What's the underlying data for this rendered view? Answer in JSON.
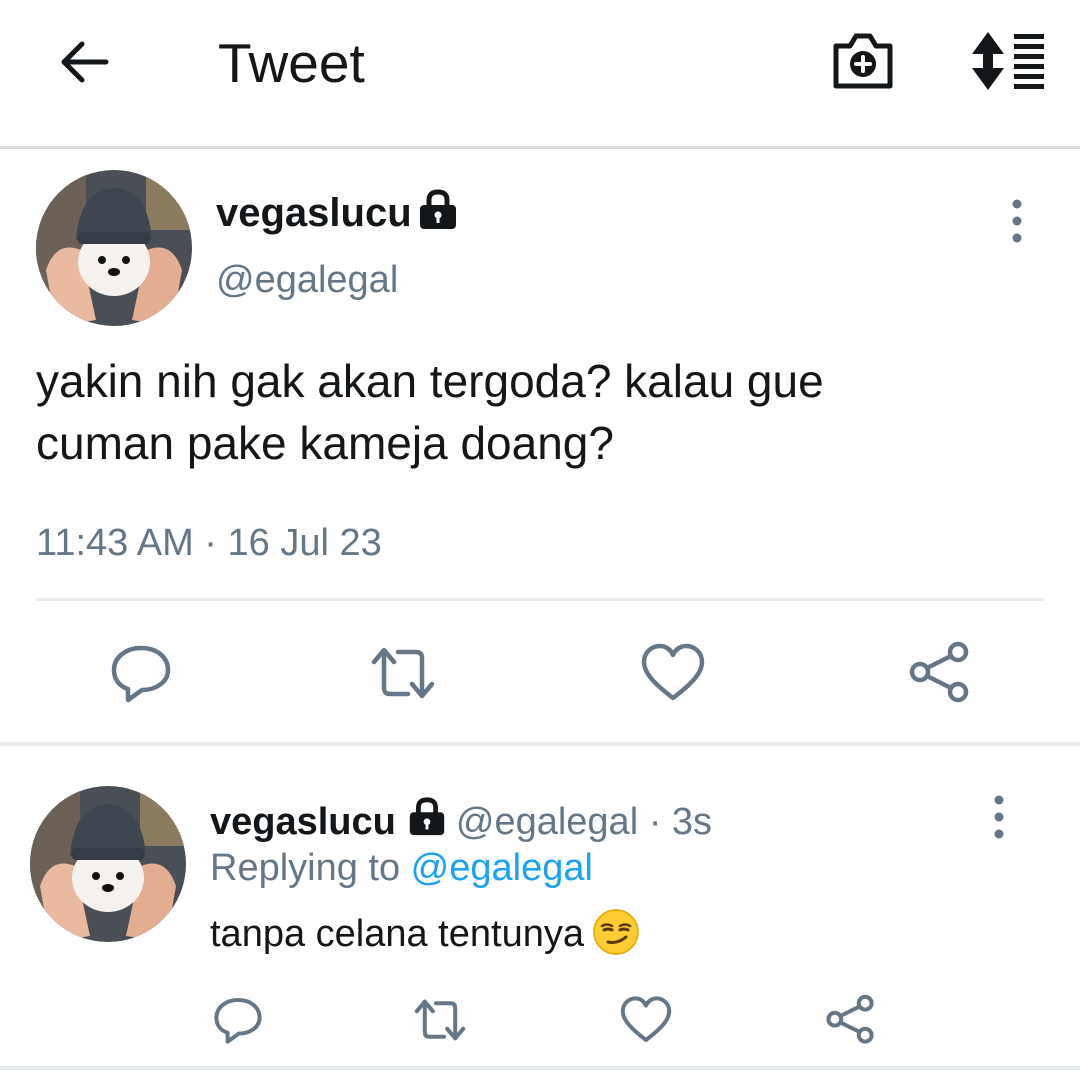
{
  "header": {
    "title": "Tweet",
    "back_icon": "arrow-left-icon",
    "camera_icon": "camera-add-icon",
    "sort_icon": "sort-list-icon"
  },
  "main_tweet": {
    "display_name": "vegaslucu",
    "handle": "@egalegal",
    "text_line1": "yakin nih gak akan tergoda? kalau gue",
    "text_line2": "cuman pake kameja doang?",
    "timestamp": "11:43 AM · 16 Jul 23",
    "protected_icon": "lock-icon",
    "more_icon": "more-vertical-icon"
  },
  "reply_tweet": {
    "display_name": "vegaslucu",
    "handle": "@egalegal",
    "separator": " · ",
    "time_ago": "3s",
    "replying_to_prefix": "Replying to ",
    "replying_to_handle": "@egalegal",
    "text": "tanpa celana tentunya",
    "emoji": "smirking-face-emoji"
  },
  "colors": {
    "text_primary": "#14171a",
    "text_secondary": "#657786",
    "link_blue": "#1da1f2",
    "divider": "#e6ecf0"
  }
}
